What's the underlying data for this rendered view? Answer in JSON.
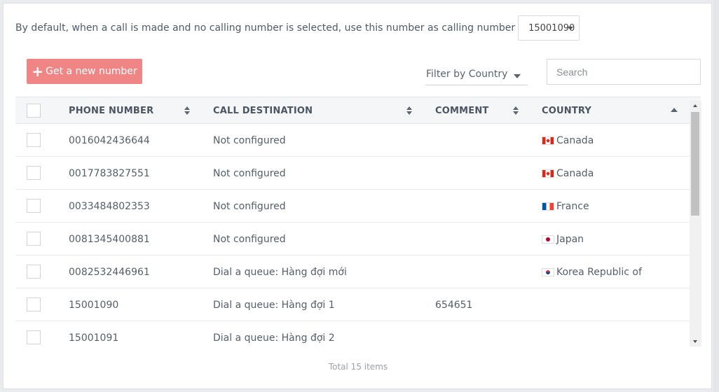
{
  "default_number": {
    "text": "By default, when a call is made and no calling number is selected, use this number as calling number",
    "selected": "15001090"
  },
  "toolbar": {
    "new_number_label": "Get a new number",
    "filter_label": "Filter by Country",
    "search_placeholder": "Search"
  },
  "table": {
    "headers": {
      "phone": "PHONE NUMBER",
      "destination": "CALL DESTINATION",
      "comment": "COMMENT",
      "country": "COUNTRY"
    },
    "rows": [
      {
        "phone": "0016042436644",
        "destination": "Not configured",
        "comment": "",
        "country": "Canada",
        "flag": "ca"
      },
      {
        "phone": "0017783827551",
        "destination": "Not configured",
        "comment": "",
        "country": "Canada",
        "flag": "ca"
      },
      {
        "phone": "0033484802353",
        "destination": "Not configured",
        "comment": "",
        "country": "France",
        "flag": "fr"
      },
      {
        "phone": "0081345400881",
        "destination": "Not configured",
        "comment": "",
        "country": "Japan",
        "flag": "jp"
      },
      {
        "phone": "0082532446961",
        "destination": "Dial a queue: Hàng đợi mới",
        "comment": "",
        "country": "Korea Republic of",
        "flag": "kr"
      },
      {
        "phone": "15001090",
        "destination": "Dial a queue: Hàng đợi 1",
        "comment": "654651",
        "country": "",
        "flag": ""
      },
      {
        "phone": "15001091",
        "destination": "Dial a queue: Hàng đợi 2",
        "comment": "",
        "country": "",
        "flag": ""
      }
    ]
  },
  "footer": {
    "total": "Total 15 items"
  }
}
